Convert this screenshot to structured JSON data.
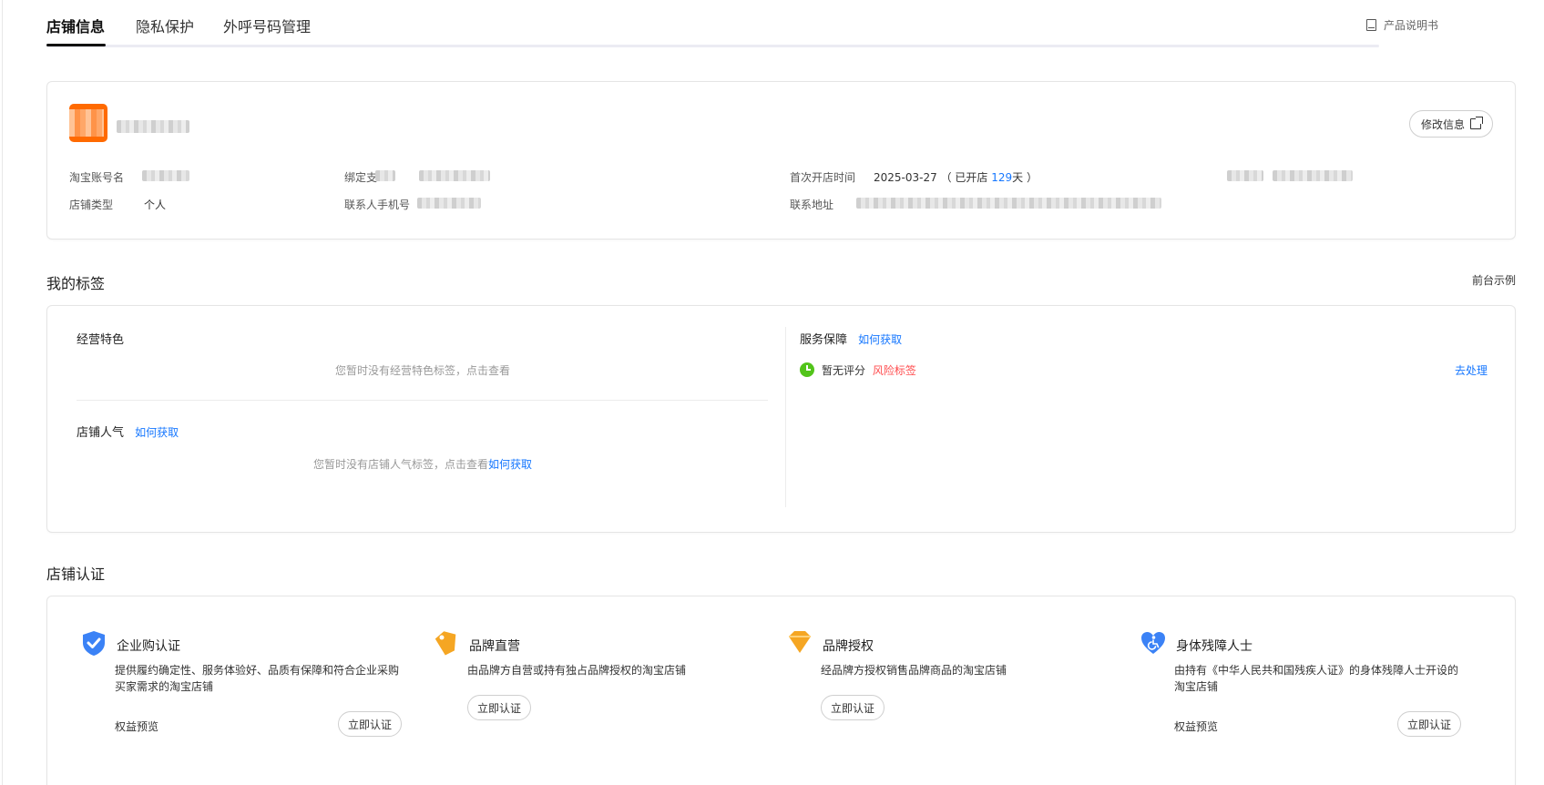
{
  "tabs": [
    {
      "label": "店铺信息",
      "active": true
    },
    {
      "label": "隐私保护",
      "active": false
    },
    {
      "label": "外呼号码管理",
      "active": false
    }
  ],
  "header": {
    "manual_label": "产品说明书",
    "manual_icon": "book-icon"
  },
  "shop": {
    "edit_label": "修改信息",
    "taobao_account_label": "淘宝账号名",
    "shop_type_label": "店铺类型",
    "shop_type_value": "个人",
    "bind_label": "绑定支",
    "contact_phone_label": "联系人手机号",
    "first_open_label": "首次开店时间",
    "first_open_date": "2025-03-27",
    "open_prefix": "（ 已开店 ",
    "open_days": "129",
    "open_suffix": "天 ）",
    "address_label": "联系地址"
  },
  "tags_section": {
    "title": "我的标签",
    "front_example": "前台示例",
    "business_features_title": "经营特色",
    "business_features_empty": "您暂时没有经营特色标签，点击查看",
    "popularity_title": "店铺人气",
    "popularity_how": "如何获取",
    "popularity_empty": "您暂时没有店铺人气标签，点击查看",
    "popularity_empty_link": "如何获取",
    "service_title": "服务保障",
    "service_how": "如何获取",
    "service_status": "暂无评分",
    "risk_tag": "风险标签",
    "handle_link": "去处理"
  },
  "cert_section": {
    "title": "店铺认证",
    "items": [
      {
        "title": "企业购认证",
        "icon": "shield-check-icon",
        "desc": "提供履约确定性、服务体验好、品质有保障和符合企业采购买家需求的淘宝店铺",
        "benefit": "权益预览",
        "button": "立即认证"
      },
      {
        "title": "品牌直营",
        "icon": "brand-tag-icon",
        "desc": "由品牌方自营或持有独占品牌授权的淘宝店铺",
        "button": "立即认证"
      },
      {
        "title": "品牌授权",
        "icon": "diamond-badge-icon",
        "desc": "经品牌方授权销售品牌商品的淘宝店铺",
        "button": "立即认证"
      },
      {
        "title": "身体残障人士",
        "icon": "heart-accessibility-icon",
        "desc": "由持有《中华人民共和国残疾人证》的身体残障人士开设的淘宝店铺",
        "benefit": "权益预览",
        "button": "立即认证"
      }
    ]
  },
  "colors": {
    "accent_blue": "#1677ff",
    "risk_red": "#ff4d4f",
    "logo_orange": "#ff6a00",
    "status_green": "#52c41a"
  }
}
